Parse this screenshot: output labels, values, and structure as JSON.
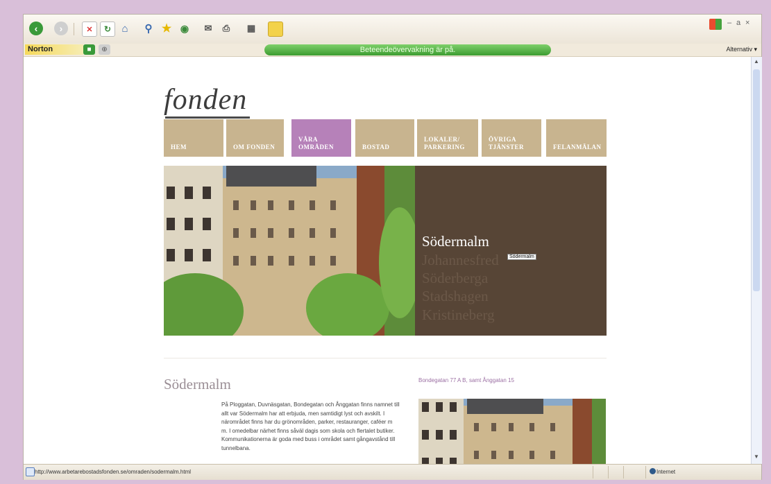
{
  "norton": {
    "brand": "Norton",
    "status": "Beteendeövervakning är på.",
    "options": "Alternativ ▾"
  },
  "window_controls": [
    "–",
    "a",
    "×"
  ],
  "site": {
    "logo": "fonden",
    "nav": [
      {
        "line1": "",
        "line2": "HEM",
        "active": false
      },
      {
        "line1": "",
        "line2": "OM FONDEN",
        "active": false
      },
      {
        "line1": "VÅRA",
        "line2": "OMRÅDEN",
        "active": true
      },
      {
        "line1": "",
        "line2": "BOSTAD",
        "active": false
      },
      {
        "line1": "LOKALER/",
        "line2": "PARKERING",
        "active": false
      },
      {
        "line1": "ÖVRIGA",
        "line2": "TJÄNSTER",
        "active": false
      },
      {
        "line1": "",
        "line2": "FELANMÄLAN",
        "active": false
      }
    ],
    "areas": [
      "Södermalm",
      "Johannesfred",
      "Söderberga",
      "Stadshagen",
      "Kristineberg"
    ],
    "tooltip": "Södermalm",
    "page_title": "Södermalm",
    "body": "På Ploggatan, Duvnäsgatan, Bondegatan och Ånggatan finns namnet till allt var Södermalm har att erbjuda, men samtidigt lyst och avskilt. I närområdet finns har du grönområden, parker, restauranger, caféer m m. I omedelbar närhet finns såväl dagis som skola och flertalet butiker. Kommunikationerna är goda med buss i området samt gångavstånd till tunnelbana.",
    "side_caption": "Bondegatan 77 A B, samt Ånggatan 15"
  },
  "status": {
    "url": "http://www.arbetarebostadsfonden.se/omraden/sodermalm.html",
    "zone": "Internet"
  },
  "colors": {
    "nav_bg": "#c8b48f",
    "nav_active": "#b681b9",
    "panel": "#574536",
    "frame": "#d9bfd9"
  }
}
